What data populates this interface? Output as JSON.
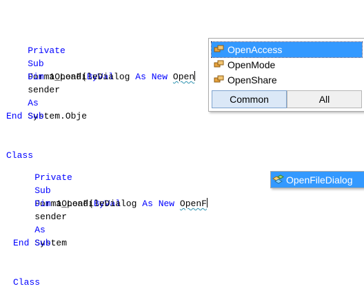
{
  "snippet1": {
    "line1": {
      "kw1": "Private",
      "kw2": "Sub",
      "name": "Form1_Load(",
      "kw3": "ByVal",
      "param": "sender",
      "kw4": "As",
      "type": "System.Obje"
    },
    "line2": {
      "kw1": "Dim",
      "var": "aOpenFileDialog",
      "kw2": "As",
      "kw3": "New",
      "typed": "Open"
    },
    "line3": {
      "kw1": "End",
      "kw2": "Sub"
    },
    "line4": {
      "kw1": "Class"
    }
  },
  "intellisense1": {
    "items": [
      {
        "label": "OpenAccess",
        "icon": "enum-icon",
        "selected": true
      },
      {
        "label": "OpenMode",
        "icon": "enum-icon",
        "selected": false
      },
      {
        "label": "OpenShare",
        "icon": "enum-icon",
        "selected": false
      }
    ],
    "tabs": {
      "common": "Common",
      "all": "All"
    }
  },
  "snippet2": {
    "line1": {
      "kw1": "Private",
      "kw2": "Sub",
      "name": "Form1_Load(",
      "kw3": "ByVal",
      "param": "sender",
      "kw4": "As",
      "type": "System"
    },
    "line2": {
      "kw1": "Dim",
      "var": "aOpenFileDialog",
      "kw2": "As",
      "kw3": "New",
      "typed": "OpenF"
    },
    "line3": {
      "kw1": "End",
      "kw2": "Sub"
    },
    "line4": {
      "kw1": "Class"
    }
  },
  "intellisense2": {
    "item": {
      "label": "OpenFileDialog",
      "icon": "class-icon",
      "selected": true
    }
  },
  "colors": {
    "keyword": "#0000ff",
    "selection": "#3399ff",
    "squiggle": "#2b91af"
  }
}
